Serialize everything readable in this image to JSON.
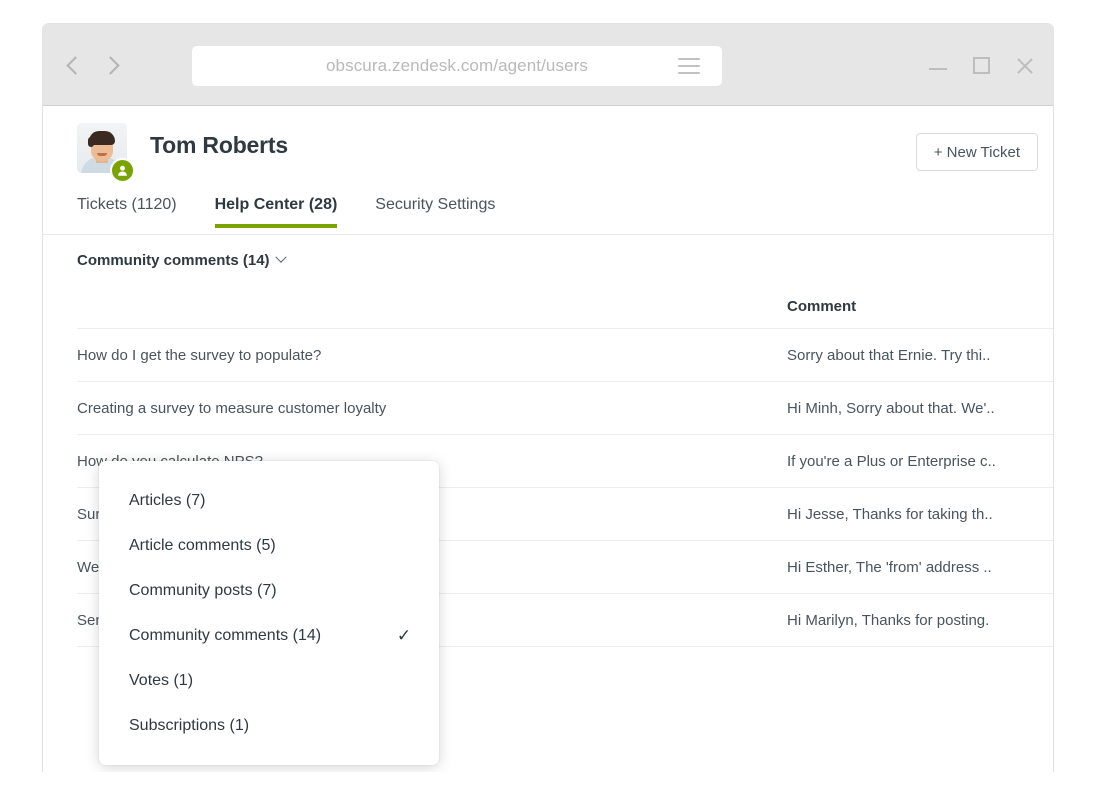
{
  "browser": {
    "back_icon": "chevron-left-icon",
    "forward_icon": "chevron-right-icon",
    "url": "obscura.zendesk.com/agent/users",
    "menu_icon": "hamburger-icon",
    "minimize_icon": "minimize-icon",
    "maximize_icon": "maximize-icon",
    "close_icon": "close-icon"
  },
  "user": {
    "name": "Tom Roberts",
    "avatar_alt": "user-avatar-photo",
    "badge_icon": "user-badge-icon",
    "badge_color": "#78a300"
  },
  "actions": {
    "new_ticket": "+ New Ticket"
  },
  "tabs": [
    {
      "label": "Tickets (1120)",
      "active": false
    },
    {
      "label": "Help Center (28)",
      "active": true
    },
    {
      "label": "Security Settings",
      "active": false
    }
  ],
  "active_tab_color": "#78a300",
  "filter": {
    "selected_label": "Community comments (14)",
    "caret_icon": "chevron-down-icon",
    "options": [
      {
        "label": "Articles (7)",
        "selected": false
      },
      {
        "label": "Article comments (5)",
        "selected": false
      },
      {
        "label": "Community posts (7)",
        "selected": false
      },
      {
        "label": "Community comments (14)",
        "selected": true
      },
      {
        "label": "Votes (1)",
        "selected": false
      },
      {
        "label": "Subscriptions (1)",
        "selected": false
      }
    ],
    "check_glyph": "✓"
  },
  "table": {
    "columns": [
      "",
      "Comment"
    ],
    "rows": [
      {
        "title": "How do I get the survey to populate?",
        "comment": "Sorry about that Ernie. Try thi.."
      },
      {
        "title": "Creating a survey to measure customer loyalty",
        "comment": "Hi Minh, Sorry about that. We'.."
      },
      {
        "title": "How do you calculate NPS?",
        "comment": "If you're a Plus or Enterprise c.."
      },
      {
        "title": "Survey response rates",
        "comment": "Hi Jesse, Thanks for taking th.."
      },
      {
        "title": "Welcome to the beta (powered by Zendesk)",
        "comment": "Hi Esther, The 'from' address .."
      },
      {
        "title": "Sending Reminders for Survey",
        "comment": "Hi Marilyn, Thanks for posting."
      }
    ]
  }
}
